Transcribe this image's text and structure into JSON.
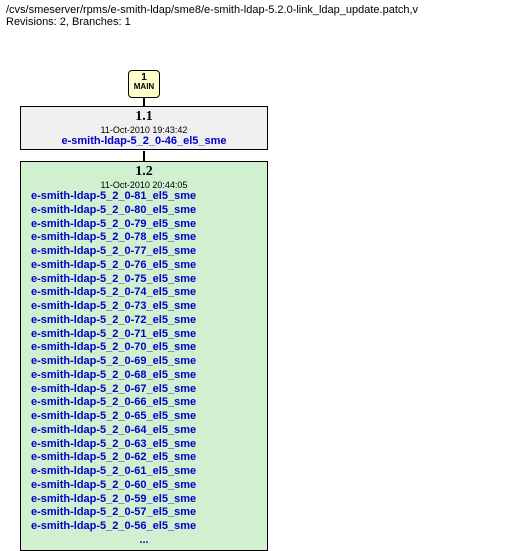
{
  "header": {
    "path": "/cvs/smeserver/rpms/e-smith-ldap/sme8/e-smith-ldap-5.2.0-link_ldap_update.patch,v",
    "revisions_label": "Revisions: 2, Branches: 1"
  },
  "main_node": {
    "number": "1",
    "label": "MAIN"
  },
  "node11": {
    "title": "1.1",
    "date": "11-Oct-2010 19:43:42",
    "file": "e-smith-ldap-5_2_0-46_el5_sme"
  },
  "node12": {
    "title": "1.2",
    "date": "11-Oct-2010 20:44:05",
    "files": [
      "e-smith-ldap-5_2_0-81_el5_sme",
      "e-smith-ldap-5_2_0-80_el5_sme",
      "e-smith-ldap-5_2_0-79_el5_sme",
      "e-smith-ldap-5_2_0-78_el5_sme",
      "e-smith-ldap-5_2_0-77_el5_sme",
      "e-smith-ldap-5_2_0-76_el5_sme",
      "e-smith-ldap-5_2_0-75_el5_sme",
      "e-smith-ldap-5_2_0-74_el5_sme",
      "e-smith-ldap-5_2_0-73_el5_sme",
      "e-smith-ldap-5_2_0-72_el5_sme",
      "e-smith-ldap-5_2_0-71_el5_sme",
      "e-smith-ldap-5_2_0-70_el5_sme",
      "e-smith-ldap-5_2_0-69_el5_sme",
      "e-smith-ldap-5_2_0-68_el5_sme",
      "e-smith-ldap-5_2_0-67_el5_sme",
      "e-smith-ldap-5_2_0-66_el5_sme",
      "e-smith-ldap-5_2_0-65_el5_sme",
      "e-smith-ldap-5_2_0-64_el5_sme",
      "e-smith-ldap-5_2_0-63_el5_sme",
      "e-smith-ldap-5_2_0-62_el5_sme",
      "e-smith-ldap-5_2_0-61_el5_sme",
      "e-smith-ldap-5_2_0-60_el5_sme",
      "e-smith-ldap-5_2_0-59_el5_sme",
      "e-smith-ldap-5_2_0-57_el5_sme",
      "e-smith-ldap-5_2_0-56_el5_sme"
    ],
    "ellipsis": "..."
  }
}
